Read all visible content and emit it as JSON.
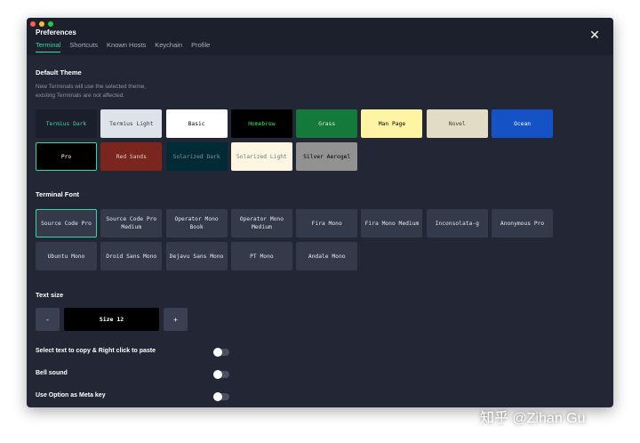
{
  "window": {
    "title": "Preferences",
    "tabs": [
      "Terminal",
      "Shortcuts",
      "Known Hosts",
      "Keychain",
      "Profile"
    ],
    "active_tab": "Terminal"
  },
  "theme_section": {
    "title": "Default Theme",
    "description_line1": "New Terminals will use the selected theme,",
    "description_line2": "existing Terminals are not affected.",
    "themes": [
      {
        "name": "Termius Dark",
        "bg": "#1b1e2b",
        "fg": "#3ad6a0",
        "selected": false
      },
      {
        "name": "Termius Light",
        "bg": "#dde3e8",
        "fg": "#33384a",
        "selected": false
      },
      {
        "name": "Basic",
        "bg": "#ffffff",
        "fg": "#000000",
        "selected": false
      },
      {
        "name": "Homebrew",
        "bg": "#000000",
        "fg": "#29f05a",
        "selected": false
      },
      {
        "name": "Grass",
        "bg": "#137a3c",
        "fg": "#f2ecbf",
        "selected": false
      },
      {
        "name": "Man Page",
        "bg": "#fff4a3",
        "fg": "#000000",
        "selected": false
      },
      {
        "name": "Novel",
        "bg": "#e2dbc5",
        "fg": "#4c3a28",
        "selected": false
      },
      {
        "name": "Ocean",
        "bg": "#1452c6",
        "fg": "#ffffff",
        "selected": false
      },
      {
        "name": "Pro",
        "bg": "#000000",
        "fg": "#ffffff",
        "selected": true
      },
      {
        "name": "Red Sands",
        "bg": "#7a251e",
        "fg": "#dbd2c0",
        "selected": false
      },
      {
        "name": "Solarized Dark",
        "bg": "#002b36",
        "fg": "#839496",
        "selected": false
      },
      {
        "name": "Solarized Light",
        "bg": "#fdf6e3",
        "fg": "#657b83",
        "selected": false
      },
      {
        "name": "Silver Aerogel",
        "bg": "#929292",
        "fg": "#000000",
        "selected": false
      }
    ]
  },
  "font_section": {
    "title": "Terminal Font",
    "fonts": [
      {
        "name": "Source Code Pro",
        "selected": true
      },
      {
        "name": "Source Code Pro Medium",
        "selected": false
      },
      {
        "name": "Operator Mono Book",
        "selected": false
      },
      {
        "name": "Operator Mono Medium",
        "selected": false
      },
      {
        "name": "Fira Mono",
        "selected": false
      },
      {
        "name": "Fira Mono Medium",
        "selected": false
      },
      {
        "name": "Inconsolata-g",
        "selected": false
      },
      {
        "name": "Anonymous Pro",
        "selected": false
      },
      {
        "name": "Ubuntu Mono",
        "selected": false
      },
      {
        "name": "Droid Sans Mono",
        "selected": false
      },
      {
        "name": "Dejavu Sans Mono",
        "selected": false
      },
      {
        "name": "PT Mono",
        "selected": false
      },
      {
        "name": "Andale Mono",
        "selected": false
      }
    ]
  },
  "text_size": {
    "title": "Text size",
    "decrease_label": "-",
    "value_label": "Size 12",
    "increase_label": "+"
  },
  "settings": {
    "copy_paste_label": "Select text to copy & Right click to paste",
    "bell_label": "Bell sound",
    "meta_key_label": "Use Option as Meta key"
  },
  "watermark": "知乎 @Zihan Gu",
  "colors": {
    "accent": "#3ad6a0",
    "window_bg": "#232635",
    "titlebar_bg": "#1c1f2c",
    "card_bg": "#353a4b"
  }
}
